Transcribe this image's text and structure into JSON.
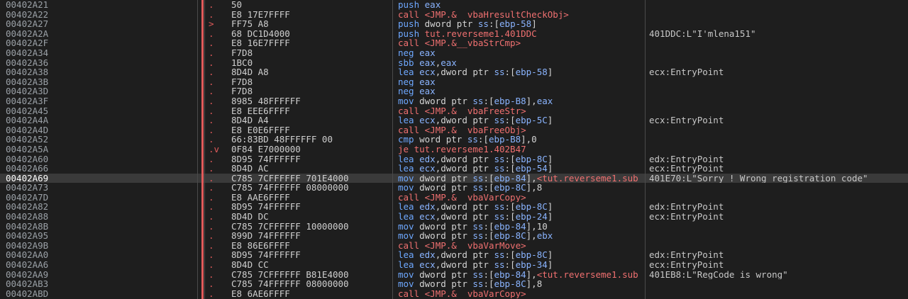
{
  "rows": [
    {
      "addr": "00402A21",
      "mark": ".",
      "bytes": "50",
      "mn": "push",
      "ops": [
        {
          "t": "eax",
          "c": "op-reg"
        }
      ],
      "cmt": ""
    },
    {
      "addr": "00402A22",
      "mark": ".",
      "bytes": "E8 17E7FFFF",
      "mn": "call",
      "ops": [
        {
          "t": "<JMP.&__vbaHresultCheckObj>",
          "c": "op-tgt"
        }
      ],
      "cmt": ""
    },
    {
      "addr": "00402A27",
      "mark": ">",
      "bytes": "FF75 A8",
      "mn": "push",
      "ops": [
        {
          "t": "dword ptr ",
          "c": "op-plain"
        },
        {
          "t": "ss",
          "c": "op-reg"
        },
        {
          "t": ":[",
          "c": "op-plain"
        },
        {
          "t": "ebp-58",
          "c": "op-reg"
        },
        {
          "t": "]",
          "c": "op-plain"
        }
      ],
      "cmt": ""
    },
    {
      "addr": "00402A2A",
      "mark": ".",
      "bytes": "68 DC1D4000",
      "mn": "push",
      "ops": [
        {
          "t": "tut.reverseme1.401DDC",
          "c": "op-tgt"
        }
      ],
      "cmt": "401DDC:L\"I'mlena151\""
    },
    {
      "addr": "00402A2F",
      "mark": ".",
      "bytes": "E8 16E7FFFF",
      "mn": "call",
      "ops": [
        {
          "t": "<JMP.&__vbaStrCmp>",
          "c": "op-tgt"
        }
      ],
      "cmt": ""
    },
    {
      "addr": "00402A34",
      "mark": ".",
      "bytes": "F7D8",
      "mn": "neg",
      "ops": [
        {
          "t": "eax",
          "c": "op-reg"
        }
      ],
      "cmt": ""
    },
    {
      "addr": "00402A36",
      "mark": ".",
      "bytes": "1BC0",
      "mn": "sbb",
      "ops": [
        {
          "t": "eax",
          "c": "op-reg"
        },
        {
          "t": ",",
          "c": "op-plain"
        },
        {
          "t": "eax",
          "c": "op-reg"
        }
      ],
      "cmt": ""
    },
    {
      "addr": "00402A38",
      "mark": ".",
      "bytes": "8D4D A8",
      "mn": "lea",
      "ops": [
        {
          "t": "ecx",
          "c": "op-reg"
        },
        {
          "t": ",dword ptr ",
          "c": "op-plain"
        },
        {
          "t": "ss",
          "c": "op-reg"
        },
        {
          "t": ":[",
          "c": "op-plain"
        },
        {
          "t": "ebp-58",
          "c": "op-reg"
        },
        {
          "t": "]",
          "c": "op-plain"
        }
      ],
      "cmt": "ecx:EntryPoint"
    },
    {
      "addr": "00402A3B",
      "mark": ".",
      "bytes": "F7D8",
      "mn": "neg",
      "ops": [
        {
          "t": "eax",
          "c": "op-reg"
        }
      ],
      "cmt": ""
    },
    {
      "addr": "00402A3D",
      "mark": ".",
      "bytes": "F7D8",
      "mn": "neg",
      "ops": [
        {
          "t": "eax",
          "c": "op-reg"
        }
      ],
      "cmt": ""
    },
    {
      "addr": "00402A3F",
      "mark": ".",
      "bytes": "8985 48FFFFFF",
      "mn": "mov",
      "ops": [
        {
          "t": "dword ptr ",
          "c": "op-plain"
        },
        {
          "t": "ss",
          "c": "op-reg"
        },
        {
          "t": ":[",
          "c": "op-plain"
        },
        {
          "t": "ebp-B8",
          "c": "op-reg"
        },
        {
          "t": "],",
          "c": "op-plain"
        },
        {
          "t": "eax",
          "c": "op-reg"
        }
      ],
      "cmt": ""
    },
    {
      "addr": "00402A45",
      "mark": ".",
      "bytes": "E8 EEE6FFFF",
      "mn": "call",
      "ops": [
        {
          "t": "<JMP.&__vbaFreeStr>",
          "c": "op-tgt"
        }
      ],
      "cmt": ""
    },
    {
      "addr": "00402A4A",
      "mark": ".",
      "bytes": "8D4D A4",
      "mn": "lea",
      "ops": [
        {
          "t": "ecx",
          "c": "op-reg"
        },
        {
          "t": ",dword ptr ",
          "c": "op-plain"
        },
        {
          "t": "ss",
          "c": "op-reg"
        },
        {
          "t": ":[",
          "c": "op-plain"
        },
        {
          "t": "ebp-5C",
          "c": "op-reg"
        },
        {
          "t": "]",
          "c": "op-plain"
        }
      ],
      "cmt": "ecx:EntryPoint"
    },
    {
      "addr": "00402A4D",
      "mark": ".",
      "bytes": "E8 E0E6FFFF",
      "mn": "call",
      "ops": [
        {
          "t": "<JMP.&__vbaFreeObj>",
          "c": "op-tgt"
        }
      ],
      "cmt": ""
    },
    {
      "addr": "00402A52",
      "mark": ".",
      "bytes": "66:83BD 48FFFFFF 00",
      "mn": "cmp",
      "ops": [
        {
          "t": "word ptr ",
          "c": "op-plain"
        },
        {
          "t": "ss",
          "c": "op-reg"
        },
        {
          "t": ":[",
          "c": "op-plain"
        },
        {
          "t": "ebp-B8",
          "c": "op-reg"
        },
        {
          "t": "],0",
          "c": "op-plain"
        }
      ],
      "cmt": ""
    },
    {
      "addr": "00402A5A",
      "mark": ".v",
      "bytes": "0F84 E7000000",
      "mn": "je",
      "ops": [
        {
          "t": "tut.reverseme1.402B47",
          "c": "op-tgt"
        }
      ],
      "cmt": ""
    },
    {
      "addr": "00402A60",
      "mark": ".",
      "bytes": "8D95 74FFFFFF",
      "mn": "lea",
      "ops": [
        {
          "t": "edx",
          "c": "op-reg"
        },
        {
          "t": ",dword ptr ",
          "c": "op-plain"
        },
        {
          "t": "ss",
          "c": "op-reg"
        },
        {
          "t": ":[",
          "c": "op-plain"
        },
        {
          "t": "ebp-8C",
          "c": "op-reg"
        },
        {
          "t": "]",
          "c": "op-plain"
        }
      ],
      "cmt": "edx:EntryPoint"
    },
    {
      "addr": "00402A66",
      "mark": ".",
      "bytes": "8D4D AC",
      "mn": "lea",
      "ops": [
        {
          "t": "ecx",
          "c": "op-reg"
        },
        {
          "t": ",dword ptr ",
          "c": "op-plain"
        },
        {
          "t": "ss",
          "c": "op-reg"
        },
        {
          "t": ":[",
          "c": "op-plain"
        },
        {
          "t": "ebp-54",
          "c": "op-reg"
        },
        {
          "t": "]",
          "c": "op-plain"
        }
      ],
      "cmt": "ecx:EntryPoint"
    },
    {
      "addr": "00402A69",
      "mark": ".",
      "bytes": "C785 7CFFFFFF 701E4000",
      "mn": "mov",
      "sel": true,
      "ops": [
        {
          "t": "dword ptr ",
          "c": "op-plain"
        },
        {
          "t": "ss",
          "c": "op-reg"
        },
        {
          "t": ":[",
          "c": "op-plain"
        },
        {
          "t": "ebp-84",
          "c": "op-reg"
        },
        {
          "t": "],",
          "c": "op-plain"
        },
        {
          "t": "<tut.reverseme1.sub",
          "c": "op-tgt"
        }
      ],
      "cmt": "401E70:L\"Sorry ! Wrong registration code\""
    },
    {
      "addr": "00402A73",
      "mark": ".",
      "bytes": "C785 74FFFFFF 08000000",
      "mn": "mov",
      "ops": [
        {
          "t": "dword ptr ",
          "c": "op-plain"
        },
        {
          "t": "ss",
          "c": "op-reg"
        },
        {
          "t": ":[",
          "c": "op-plain"
        },
        {
          "t": "ebp-8C",
          "c": "op-reg"
        },
        {
          "t": "],8",
          "c": "op-plain"
        }
      ],
      "cmt": ""
    },
    {
      "addr": "00402A7D",
      "mark": ".",
      "bytes": "E8 AAE6FFFF",
      "mn": "call",
      "ops": [
        {
          "t": "<JMP.&__vbaVarCopy>",
          "c": "op-tgt"
        }
      ],
      "cmt": ""
    },
    {
      "addr": "00402A82",
      "mark": ".",
      "bytes": "8D95 74FFFFFF",
      "mn": "lea",
      "ops": [
        {
          "t": "edx",
          "c": "op-reg"
        },
        {
          "t": ",dword ptr ",
          "c": "op-plain"
        },
        {
          "t": "ss",
          "c": "op-reg"
        },
        {
          "t": ":[",
          "c": "op-plain"
        },
        {
          "t": "ebp-8C",
          "c": "op-reg"
        },
        {
          "t": "]",
          "c": "op-plain"
        }
      ],
      "cmt": "edx:EntryPoint"
    },
    {
      "addr": "00402A88",
      "mark": ".",
      "bytes": "8D4D DC",
      "mn": "lea",
      "ops": [
        {
          "t": "ecx",
          "c": "op-reg"
        },
        {
          "t": ",dword ptr ",
          "c": "op-plain"
        },
        {
          "t": "ss",
          "c": "op-reg"
        },
        {
          "t": ":[",
          "c": "op-plain"
        },
        {
          "t": "ebp-24",
          "c": "op-reg"
        },
        {
          "t": "]",
          "c": "op-plain"
        }
      ],
      "cmt": "ecx:EntryPoint"
    },
    {
      "addr": "00402A8B",
      "mark": ".",
      "bytes": "C785 7CFFFFFF 10000000",
      "mn": "mov",
      "ops": [
        {
          "t": "dword ptr ",
          "c": "op-plain"
        },
        {
          "t": "ss",
          "c": "op-reg"
        },
        {
          "t": ":[",
          "c": "op-plain"
        },
        {
          "t": "ebp-84",
          "c": "op-reg"
        },
        {
          "t": "],10",
          "c": "op-plain"
        }
      ],
      "cmt": ""
    },
    {
      "addr": "00402A95",
      "mark": ".",
      "bytes": "899D 74FFFFFF",
      "mn": "mov",
      "ops": [
        {
          "t": "dword ptr ",
          "c": "op-plain"
        },
        {
          "t": "ss",
          "c": "op-reg"
        },
        {
          "t": ":[",
          "c": "op-plain"
        },
        {
          "t": "ebp-8C",
          "c": "op-reg"
        },
        {
          "t": "],",
          "c": "op-plain"
        },
        {
          "t": "ebx",
          "c": "op-reg"
        }
      ],
      "cmt": ""
    },
    {
      "addr": "00402A9B",
      "mark": ".",
      "bytes": "E8 86E6FFFF",
      "mn": "call",
      "ops": [
        {
          "t": "<JMP.&__vbaVarMove>",
          "c": "op-tgt"
        }
      ],
      "cmt": ""
    },
    {
      "addr": "00402AA0",
      "mark": ".",
      "bytes": "8D95 74FFFFFF",
      "mn": "lea",
      "ops": [
        {
          "t": "edx",
          "c": "op-reg"
        },
        {
          "t": ",dword ptr ",
          "c": "op-plain"
        },
        {
          "t": "ss",
          "c": "op-reg"
        },
        {
          "t": ":[",
          "c": "op-plain"
        },
        {
          "t": "ebp-8C",
          "c": "op-reg"
        },
        {
          "t": "]",
          "c": "op-plain"
        }
      ],
      "cmt": "edx:EntryPoint"
    },
    {
      "addr": "00402AA6",
      "mark": ".",
      "bytes": "8D4D CC",
      "mn": "lea",
      "ops": [
        {
          "t": "ecx",
          "c": "op-reg"
        },
        {
          "t": ",dword ptr ",
          "c": "op-plain"
        },
        {
          "t": "ss",
          "c": "op-reg"
        },
        {
          "t": ":[",
          "c": "op-plain"
        },
        {
          "t": "ebp-34",
          "c": "op-reg"
        },
        {
          "t": "]",
          "c": "op-plain"
        }
      ],
      "cmt": "ecx:EntryPoint"
    },
    {
      "addr": "00402AA9",
      "mark": ".",
      "bytes": "C785 7CFFFFFF B81E4000",
      "mn": "mov",
      "ops": [
        {
          "t": "dword ptr ",
          "c": "op-plain"
        },
        {
          "t": "ss",
          "c": "op-reg"
        },
        {
          "t": ":[",
          "c": "op-plain"
        },
        {
          "t": "ebp-84",
          "c": "op-reg"
        },
        {
          "t": "],",
          "c": "op-plain"
        },
        {
          "t": "<tut.reverseme1.sub",
          "c": "op-tgt"
        }
      ],
      "cmt": "401EB8:L\"RegCode is wrong\""
    },
    {
      "addr": "00402AB3",
      "mark": ".",
      "bytes": "C785 74FFFFFF 08000000",
      "mn": "mov",
      "ops": [
        {
          "t": "dword ptr ",
          "c": "op-plain"
        },
        {
          "t": "ss",
          "c": "op-reg"
        },
        {
          "t": ":[",
          "c": "op-plain"
        },
        {
          "t": "ebp-8C",
          "c": "op-reg"
        },
        {
          "t": "],8",
          "c": "op-plain"
        }
      ],
      "cmt": ""
    },
    {
      "addr": "00402ABD",
      "mark": ".",
      "bytes": "E8 6AE6FFFF",
      "mn": "call",
      "ops": [
        {
          "t": "<JMP.&__vbaVarCopy>",
          "c": "op-tgt"
        }
      ],
      "cmt": ""
    }
  ]
}
